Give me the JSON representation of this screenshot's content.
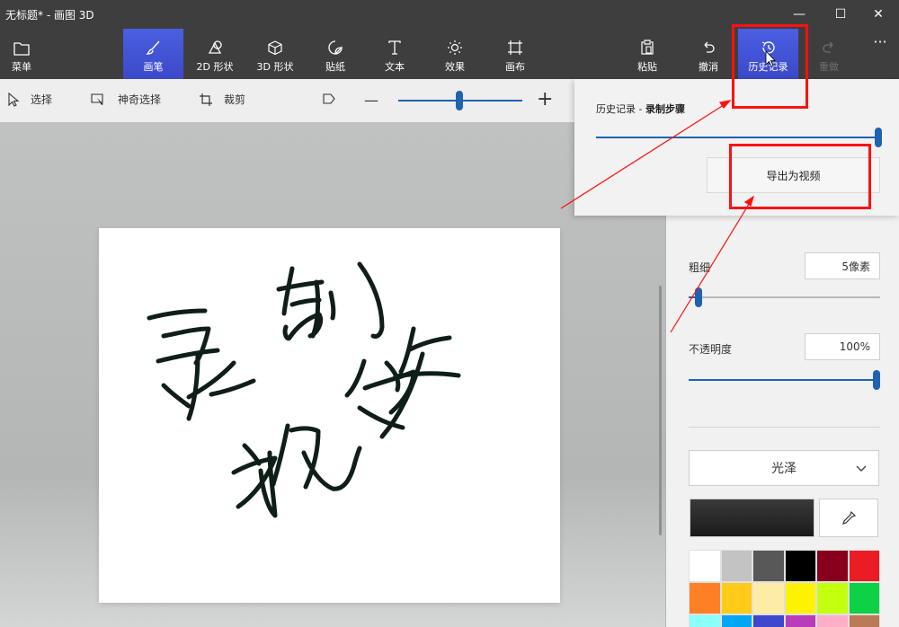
{
  "window": {
    "title": "无标题* - 画图 3D",
    "minimize_glyph": "—",
    "maximize_glyph": "☐",
    "close_glyph": "✕"
  },
  "ribbon": {
    "menu": "菜单",
    "brushes": "画笔",
    "shapes_2d": "2D 形状",
    "shapes_3d": "3D 形状",
    "stickers": "贴纸",
    "text": "文本",
    "effects": "效果",
    "canvas": "画布",
    "paste": "粘贴",
    "undo": "撤消",
    "history": "历史记录",
    "redo": "重做",
    "more": "···",
    "active_tab": "画笔",
    "accent_color": "#3b49c8"
  },
  "subtoolbar": {
    "select": "选择",
    "magic_select": "神奇选择",
    "crop": "裁剪",
    "zoom_minus": "—",
    "zoom_plus": "+",
    "zoom_level": 0.5
  },
  "history_panel": {
    "title_prefix": "历史记录 - ",
    "title_bold": "录制步骤",
    "timeline_position": 1.0,
    "export_button": "导出为视频"
  },
  "brush_panel": {
    "thickness_label": "粗细",
    "thickness_value": "5像素",
    "thickness_level": 0.05,
    "opacity_label": "不透明度",
    "opacity_value": "100%",
    "opacity_level": 1.0,
    "finish_label": "光泽",
    "current_color": "#1e1e1e",
    "palette": [
      "#ffffff",
      "#c3c3c3",
      "#585858",
      "#000000",
      "#88001b",
      "#ec1c24",
      "#ff7f27",
      "#ffca18",
      "#fdeca6",
      "#fff200",
      "#c4ff0e",
      "#0ed145",
      "#8cfffb",
      "#00a8f3",
      "#3f48cc",
      "#b83dba",
      "#ffaec8",
      "#b97a56"
    ]
  },
  "canvas": {
    "drawing": "handwritten strokes (录制步骤)"
  },
  "annotation": {
    "highlight_color": "#ff1010"
  }
}
